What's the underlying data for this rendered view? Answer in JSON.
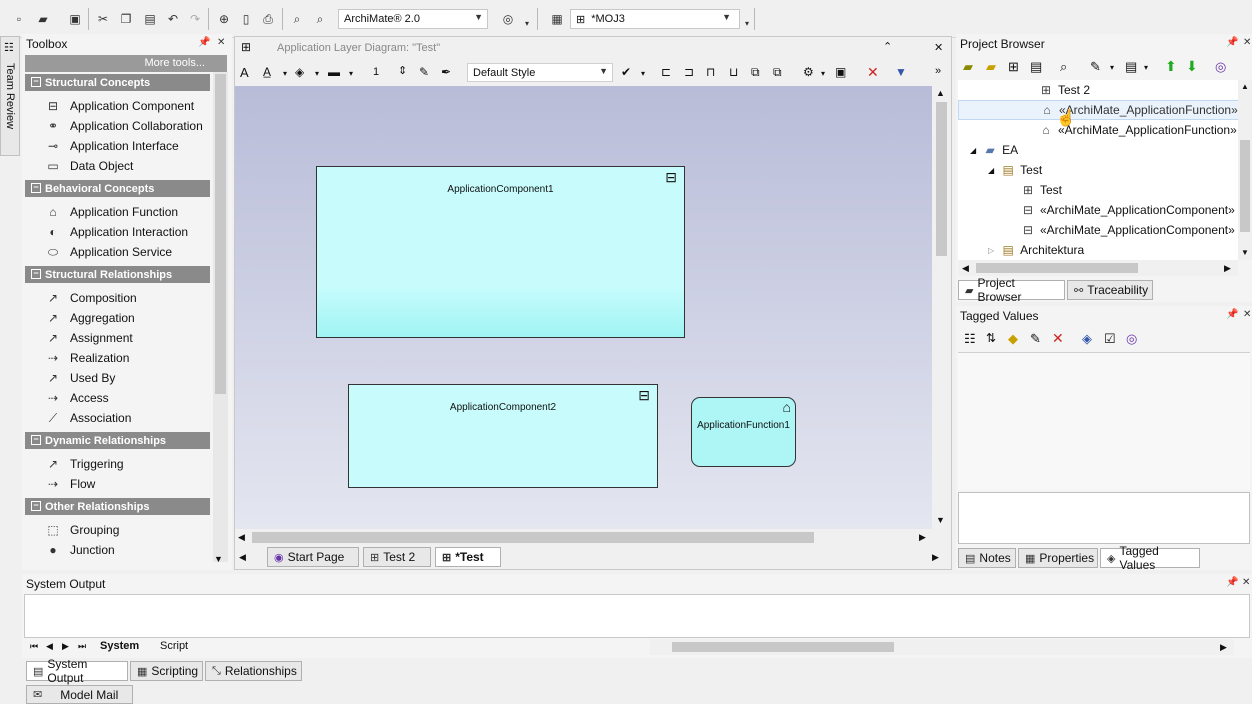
{
  "main_toolbar": {
    "model_combo": "ArchiMate® 2.0",
    "diagram_combo": "*MOJ3"
  },
  "toolbox": {
    "title": "Toolbox",
    "more_tools": "More tools...",
    "side_tab": "Team Review",
    "sections": [
      {
        "label": "Structural Concepts",
        "items": [
          "Application Component",
          "Application Collaboration",
          "Application Interface",
          "Data Object"
        ]
      },
      {
        "label": "Behavioral Concepts",
        "items": [
          "Application Function",
          "Application Interaction",
          "Application Service"
        ]
      },
      {
        "label": "Structural Relationships",
        "items": [
          "Composition",
          "Aggregation",
          "Assignment",
          "Realization",
          "Used By",
          "Access",
          "Association"
        ]
      },
      {
        "label": "Dynamic Relationships",
        "items": [
          "Triggering",
          "Flow"
        ]
      },
      {
        "label": "Other Relationships",
        "items": [
          "Grouping",
          "Junction"
        ]
      }
    ]
  },
  "diagram": {
    "title": "Application Layer Diagram: \"Test\"",
    "line_width": "1",
    "style_combo": "Default Style",
    "elements": [
      {
        "label": "ApplicationComponent1",
        "color": "#c8fcfc"
      },
      {
        "label": "ApplicationComponent2",
        "color": "#c8fcfc"
      },
      {
        "label": "ApplicationFunction1",
        "color": "#aef6f6"
      }
    ],
    "tabs": [
      "Start Page",
      "Test 2",
      "*Test"
    ]
  },
  "project_browser": {
    "title": "Project Browser",
    "tree": [
      {
        "label": "Test 2",
        "icon": "diagram-icon"
      },
      {
        "label": "«ArchiMate_ApplicationFunction» A",
        "icon": "function-icon"
      },
      {
        "label": "«ArchiMate_ApplicationFunction»",
        "icon": "function-icon"
      },
      {
        "label": "EA",
        "icon": "model-icon"
      },
      {
        "label": "Test",
        "icon": "package-icon"
      },
      {
        "label": "Test",
        "icon": "diagram-icon"
      },
      {
        "label": "«ArchiMate_ApplicationComponent»",
        "icon": "component-icon"
      },
      {
        "label": "«ArchiMate_ApplicationComponent»",
        "icon": "component-icon"
      },
      {
        "label": "Architektura",
        "icon": "package-icon"
      }
    ],
    "tabs": [
      "Project Browser",
      "Traceability"
    ]
  },
  "tagged_values": {
    "title": "Tagged Values",
    "tabs": [
      "Notes",
      "Properties",
      "Tagged Values"
    ]
  },
  "system_output": {
    "title": "System Output",
    "inner_tabs": [
      "System",
      "Script"
    ],
    "bottom_tabs": [
      "System Output",
      "Scripting",
      "Relationships"
    ],
    "model_mail": "Model Mail"
  },
  "colors": {
    "canvas_top": "#b8bcd8",
    "canvas_bottom": "#e4e6f0",
    "section_header": "#8a8a8a",
    "element_fill": "#c8fcfc"
  }
}
